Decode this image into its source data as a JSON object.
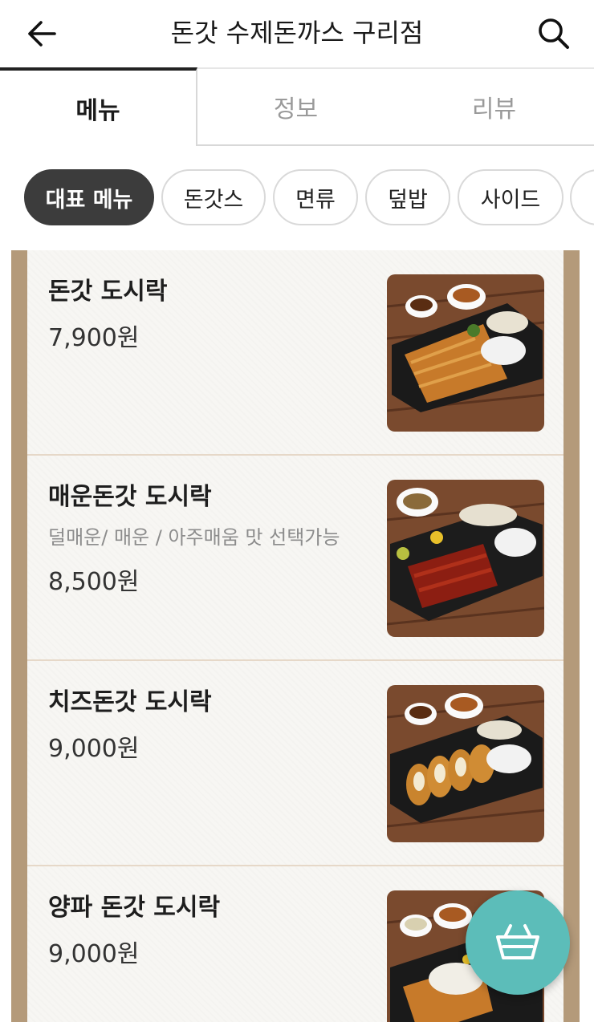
{
  "header": {
    "title": "돈갓 수제돈까스 구리점",
    "back_icon": "arrow-left-icon",
    "search_icon": "search-icon"
  },
  "tabs": [
    {
      "label": "메뉴",
      "active": true
    },
    {
      "label": "정보",
      "active": false
    },
    {
      "label": "리뷰",
      "active": false
    }
  ],
  "categories": [
    {
      "label": "대표 메뉴",
      "selected": true
    },
    {
      "label": "돈갓스",
      "selected": false
    },
    {
      "label": "면류",
      "selected": false
    },
    {
      "label": "덮밥",
      "selected": false
    },
    {
      "label": "사이드",
      "selected": false
    }
  ],
  "menu_items": [
    {
      "name": "돈갓 도시락",
      "description": "",
      "price": "7,900원",
      "dish": "tonkatsu"
    },
    {
      "name": "매운돈갓 도시락",
      "description": "덜매운/ 매운 / 아주매움 맛 선택가능",
      "price": "8,500원",
      "dish": "spicy"
    },
    {
      "name": "치즈돈갓 도시락",
      "description": "",
      "price": "9,000원",
      "dish": "cheese"
    },
    {
      "name": "양파 돈갓 도시락",
      "description": "",
      "price": "9,000원",
      "dish": "onion"
    }
  ],
  "cart": {
    "icon": "basket-icon",
    "color": "#5cbdb9"
  },
  "colors": {
    "selected_chip": "#3c3c3c",
    "board_frame": "#b49a7a",
    "paper": "#f7f6f3",
    "cart_button": "#5cbdb9"
  }
}
